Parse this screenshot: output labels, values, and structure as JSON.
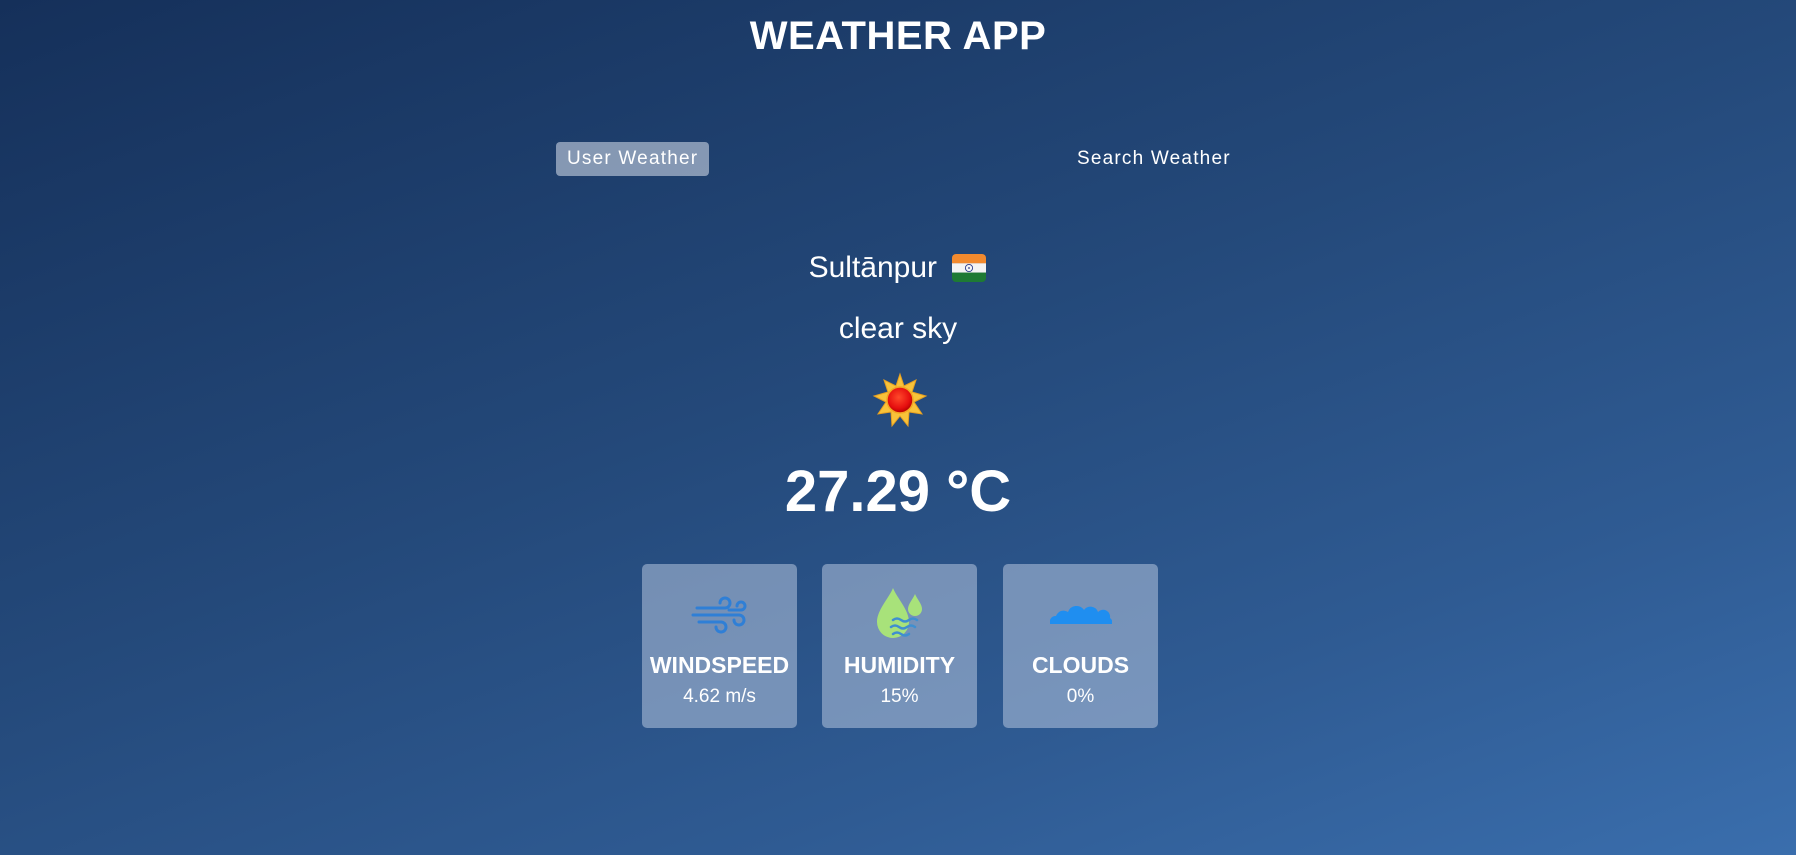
{
  "app": {
    "title": "WEATHER APP"
  },
  "tabs": [
    {
      "label": "User Weather",
      "active": true
    },
    {
      "label": "Search Weather",
      "active": false
    }
  ],
  "weather": {
    "city": "Sultānpur",
    "flag_icon": "india-flag-icon",
    "condition": "clear sky",
    "condition_icon": "sun-icon",
    "temperature": "27.29 °C"
  },
  "stats": [
    {
      "title": "WINDSPEED",
      "value": "4.62 m/s",
      "icon": "wind-icon"
    },
    {
      "title": "HUMIDITY",
      "value": "15%",
      "icon": "humidity-icon"
    },
    {
      "title": "CLOUDS",
      "value": "0%",
      "icon": "cloud-icon"
    }
  ],
  "colors": {
    "background_start": "#15305a",
    "background_end": "#3a6ead",
    "card_background": "rgba(180,196,222,0.55)",
    "text": "#ffffff"
  }
}
